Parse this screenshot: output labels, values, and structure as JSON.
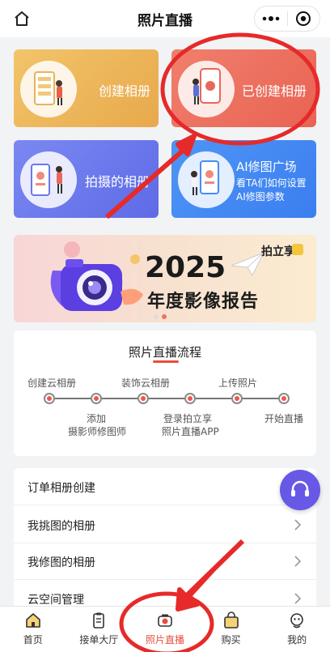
{
  "header": {
    "title": "照片直播"
  },
  "cards": [
    {
      "label": "创建相册"
    },
    {
      "label": "已创建相册"
    },
    {
      "label": "拍摄的相册"
    },
    {
      "label": "AI修图广场",
      "sub1": "看TA们如何设置",
      "sub2": "AI修图参数"
    }
  ],
  "banner": {
    "year": "2025",
    "subtitle": "年度影像报告",
    "brand": "拍立享"
  },
  "process": {
    "title": "照片直播流程",
    "top_steps": [
      "创建云相册",
      "装饰云相册",
      "上传照片"
    ],
    "bottom_steps": [
      {
        "line1": "添加",
        "line2": "摄影师修图师"
      },
      {
        "line1": "登录拍立享",
        "line2": "照片直播APP"
      },
      {
        "line1": "开始直播",
        "line2": ""
      }
    ]
  },
  "list": [
    "订单相册创建",
    "我挑图的相册",
    "我修图的相册",
    "云空间管理"
  ],
  "tabs": [
    {
      "label": "首页"
    },
    {
      "label": "接单大厅"
    },
    {
      "label": "照片直播"
    },
    {
      "label": "购买"
    },
    {
      "label": "我的"
    }
  ],
  "colors": {
    "accent": "#e94d3c",
    "annotation": "#e62a2a"
  }
}
